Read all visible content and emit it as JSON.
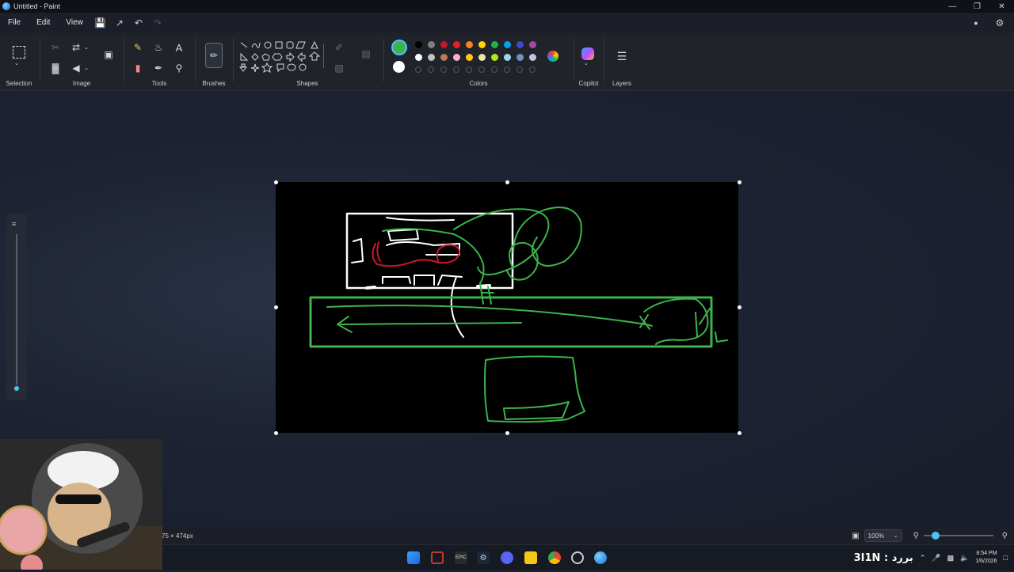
{
  "window": {
    "title": "Untitled - Paint"
  },
  "menu": {
    "file": "File",
    "edit": "Edit",
    "view": "View"
  },
  "ribbon": {
    "selection": "Selection",
    "image": "Image",
    "tools": "Tools",
    "brushes": "Brushes",
    "shapes": "Shapes",
    "colors": "Colors",
    "copilot": "Copilot",
    "layers": "Layers"
  },
  "colors": {
    "primary": "#3cb44b",
    "secondary": "#ffffff",
    "row1": [
      "#000000",
      "#7f7f7f",
      "#c0182a",
      "#ed1c24",
      "#ff7f27",
      "#ffd600",
      "#22b14c",
      "#00a2e8",
      "#3f48cc",
      "#a349a4"
    ],
    "row2": [
      "#ffffff",
      "#c3c3c3",
      "#b97a57",
      "#ffaec9",
      "#ffc90e",
      "#efe4b0",
      "#b5e61d",
      "#99d9ea",
      "#7092be",
      "#c8bfe7"
    ]
  },
  "status": {
    "canvas_size": "75 × 474px",
    "zoom": "100%"
  },
  "taskbar": {
    "overlay_text": "3I1N : بررد",
    "time": "8:54 PM",
    "date": "1/6/2026"
  }
}
